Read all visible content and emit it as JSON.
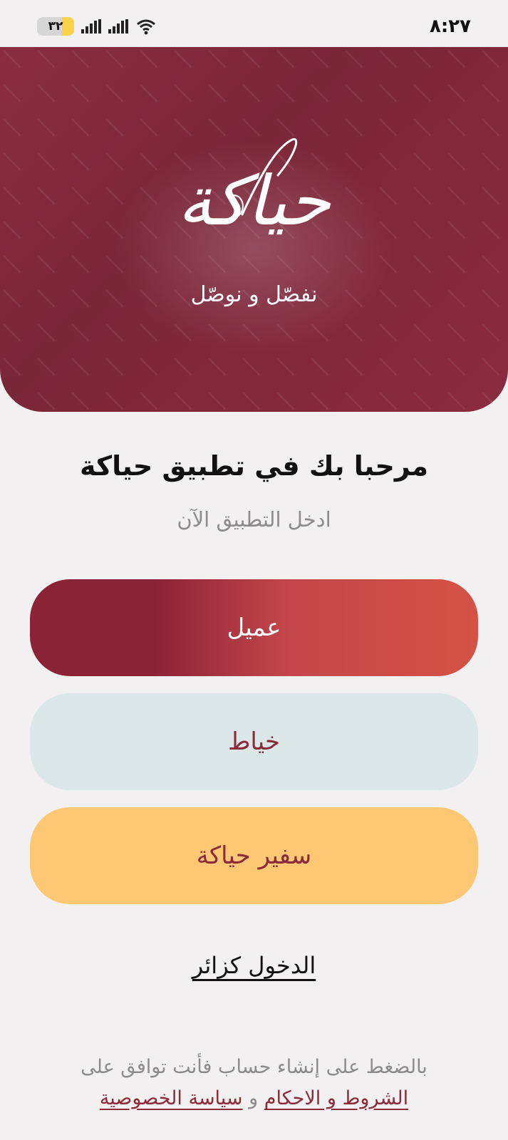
{
  "status_bar": {
    "time": "٨:٢٧",
    "battery": "٣٢",
    "battery_level": 0.32
  },
  "header": {
    "logo_text": "حياكة",
    "tagline": "نفصّل و نوصّل"
  },
  "welcome": {
    "title": "مرحبا بك في تطبيق حياكة",
    "subtitle": "ادخل التطبيق الآن"
  },
  "roles": {
    "client": "عميل",
    "tailor": "خياط",
    "ambassador": "سفير حياكة"
  },
  "guest": {
    "label": "الدخول كزائر"
  },
  "terms": {
    "prefix": "بالضغط على إنشاء حساب فأنت توافق على",
    "terms_link": "الشروط و الاحكام",
    "conjunction": "و",
    "privacy_link": "سياسة الخصوصية"
  },
  "colors": {
    "brand": "#8b2a3b",
    "header_bg": "#7a2639",
    "client_gradient_start": "#8b2337",
    "client_gradient_end": "#d45144",
    "tailor_bg": "#dce7e8",
    "ambassador_bg": "#fdc774",
    "page_bg": "#f2f0f0"
  },
  "icons": {
    "battery": "battery-icon",
    "signal": "signal-icon",
    "wifi": "wifi-icon"
  }
}
